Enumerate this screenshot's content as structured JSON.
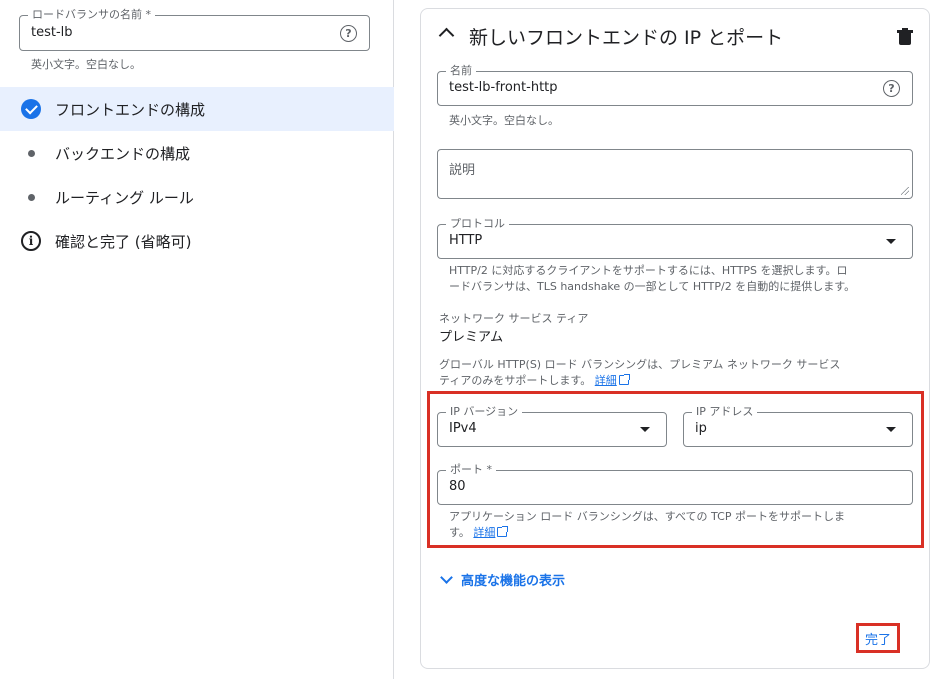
{
  "sidebar": {
    "lb_name_field": {
      "label": "ロードバランサの名前 *",
      "value": "test-lb",
      "hint": "英小文字。空白なし。"
    },
    "steps": [
      {
        "label": "フロントエンドの構成",
        "state": "completed"
      },
      {
        "label": "バックエンドの構成",
        "state": "pending"
      },
      {
        "label": "ルーティング ルール",
        "state": "pending"
      },
      {
        "label": "確認と完了 (省略可)",
        "state": "info"
      }
    ]
  },
  "frontend": {
    "title": "新しいフロントエンドの IP とポート",
    "name_field": {
      "label": "名前",
      "value": "test-lb-front-http",
      "hint": "英小文字。空白なし。"
    },
    "description_field": {
      "placeholder": "説明"
    },
    "protocol_field": {
      "label": "プロトコル",
      "value": "HTTP",
      "hint_line1": "HTTP/2 に対応するクライアントをサポートするには、HTTPS を選択します。ロ",
      "hint_line2": "ードバランサは、TLS handshake の一部として HTTP/2 を自動的に提供します。"
    },
    "network_tier": {
      "label": "ネットワーク サービス ティア",
      "value": "プレミアム",
      "note_line1": "グローバル HTTP(S) ロード バランシングは、プレミアム ネットワーク サービス",
      "note_line2": "ティアのみをサポートします。",
      "link": "詳細"
    },
    "ip_version_field": {
      "label": "IP バージョン",
      "value": "IPv4"
    },
    "ip_address_field": {
      "label": "IP アドレス",
      "value": "ip"
    },
    "port_field": {
      "label": "ポート *",
      "value": "80",
      "hint_line1": "アプリケーション ロード バランシングは、すべての TCP ポートをサポートしま",
      "hint_line2": "す。",
      "link": "詳細"
    },
    "advanced_label": "高度な機能の表示",
    "done_label": "完了"
  },
  "colors": {
    "accent": "#1a73e8",
    "highlight": "#d93025",
    "active_step_bg": "#e8f0fe"
  },
  "icons": [
    "check-circle-icon",
    "dot-icon",
    "info-icon",
    "help-icon",
    "chevron-up-icon",
    "trash-icon",
    "dropdown-arrow-icon",
    "external-link-icon",
    "chevron-down-icon"
  ]
}
